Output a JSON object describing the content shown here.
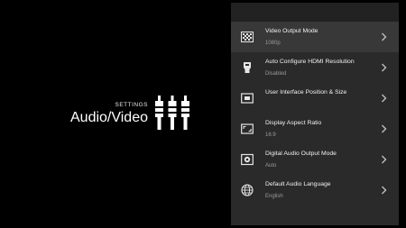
{
  "header": {
    "section_label": "SETTINGS",
    "title": "Audio/Video",
    "icon": "av-plugs-icon"
  },
  "menu": {
    "items": [
      {
        "title": "Video Output Mode",
        "value": "1080p",
        "icon": "video-pattern-icon",
        "focused": true
      },
      {
        "title": "Auto Configure HDMI Resolution",
        "value": "Disabled",
        "icon": "hdmi-icon"
      },
      {
        "title": "User Interface Position & Size",
        "value": "",
        "icon": "screen-position-icon"
      },
      {
        "title": "Display Aspect Ratio",
        "value": "16:9",
        "icon": "aspect-ratio-icon"
      },
      {
        "title": "Digital Audio Output Mode",
        "value": "Auto",
        "icon": "digital-audio-icon"
      },
      {
        "title": "Default Audio Language",
        "value": "English",
        "icon": "globe-icon"
      }
    ]
  },
  "colors": {
    "background": "#000000",
    "panel": "#2a2a2a",
    "panel_top": "#222222",
    "focused_row": "#383838",
    "title_text": "#f2f2f2",
    "value_text": "#9a9a9a"
  }
}
